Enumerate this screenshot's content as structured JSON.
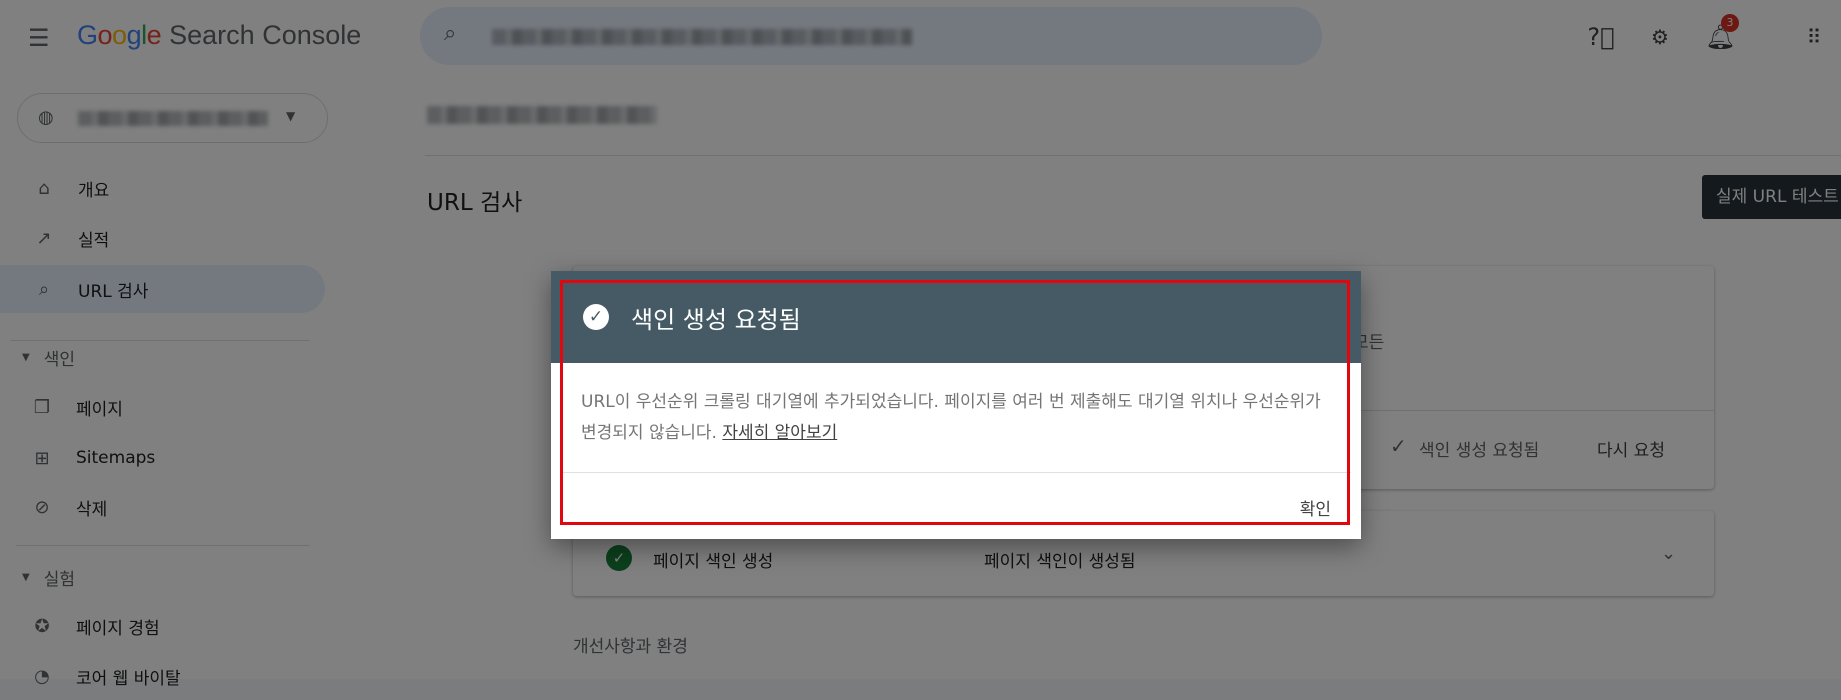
{
  "header": {
    "product": "Search Console",
    "logo_google": "Google",
    "search_placeholder": "",
    "notification_count": "3",
    "icons": [
      "menu-icon",
      "search-icon",
      "help-icon",
      "admin-settings-icon",
      "notifications-icon",
      "apps-icon"
    ]
  },
  "sidebar": {
    "items": [
      {
        "label": "개요",
        "icon": "home-icon"
      },
      {
        "label": "실적",
        "icon": "trending-icon"
      },
      {
        "label": "URL 검사",
        "icon": "search-icon",
        "active": true
      }
    ],
    "sections": [
      {
        "label": "색인",
        "items": [
          {
            "label": "페이지",
            "icon": "pages-icon"
          },
          {
            "label": "Sitemaps",
            "icon": "sitemap-icon"
          },
          {
            "label": "삭제",
            "icon": "visibility-off-icon"
          }
        ]
      },
      {
        "label": "실험",
        "items": [
          {
            "label": "페이지 경험",
            "icon": "page-experience-icon"
          },
          {
            "label": "코어 웹 바이탈",
            "icon": "gauge-icon"
          }
        ]
      }
    ]
  },
  "main": {
    "title": "URL 검사",
    "live_test_button": "실제 URL 테스트",
    "card1": {
      "partial_text": "모든",
      "status": "색인 생성 요청됨",
      "request_again": "다시 요청"
    },
    "card2": {
      "label": "페이지 색인 생성",
      "value": "페이지 색인이 생성됨"
    },
    "section_title": "개선사항과 환경"
  },
  "dialog": {
    "title": "색인 생성 요청됨",
    "body": "URL이 우선순위 크롤링 대기열에 추가되었습니다. 페이지를 여러 번 제출해도 대기열 위치나 우선순위가 변경되지 않습니다. ",
    "learn_more": "자세히 알아보기",
    "ok": "확인"
  },
  "colors": {
    "dialog_header": "#455a64",
    "highlight_box": "#e0070f",
    "success": "#188038"
  }
}
